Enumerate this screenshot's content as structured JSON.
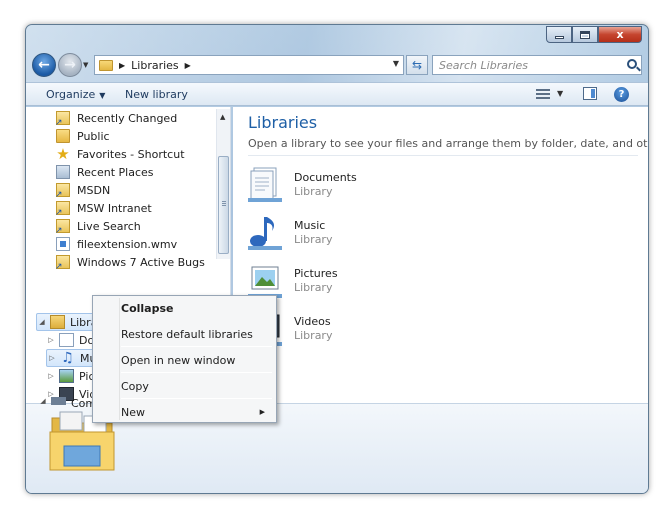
{
  "window": {
    "close_label": "x"
  },
  "address": {
    "crumb": "Libraries"
  },
  "search": {
    "placeholder": "Search Libraries"
  },
  "toolbar": {
    "organize": "Organize",
    "new_library": "New library"
  },
  "navpane": {
    "favorites": [
      {
        "label": "Recently Changed",
        "icon": "link-icon"
      },
      {
        "label": "Public",
        "icon": "folder-icon"
      },
      {
        "label": "Favorites - Shortcut",
        "icon": "star-icon"
      },
      {
        "label": "Recent Places",
        "icon": "recent-places-icon"
      },
      {
        "label": "MSDN",
        "icon": "link-icon"
      },
      {
        "label": "MSW Intranet",
        "icon": "link-icon"
      },
      {
        "label": "Live Search",
        "icon": "link-icon"
      },
      {
        "label": "fileextension.wmv",
        "icon": "video-file-icon"
      },
      {
        "label": "Windows 7 Active Bugs",
        "icon": "link-icon"
      }
    ],
    "libraries_root": "Librar",
    "library_children": [
      "Doc",
      "Mus",
      "Pict",
      "Vide"
    ],
    "computer_root": "Compu"
  },
  "context_menu": {
    "items": [
      "Collapse",
      "Restore default libraries",
      "Open in new window",
      "Copy",
      "New"
    ]
  },
  "content": {
    "title": "Libraries",
    "subtitle": "Open a library to see your files and arrange them by folder, date, and other prop...",
    "libraries": [
      {
        "name": "Documents",
        "type": "Library"
      },
      {
        "name": "Music",
        "type": "Library"
      },
      {
        "name": "Pictures",
        "type": "Library"
      },
      {
        "name": "Videos",
        "type": "Library"
      }
    ]
  },
  "colors": {
    "title_blue": "#1e5fa6",
    "close_red": "#c5452f"
  }
}
